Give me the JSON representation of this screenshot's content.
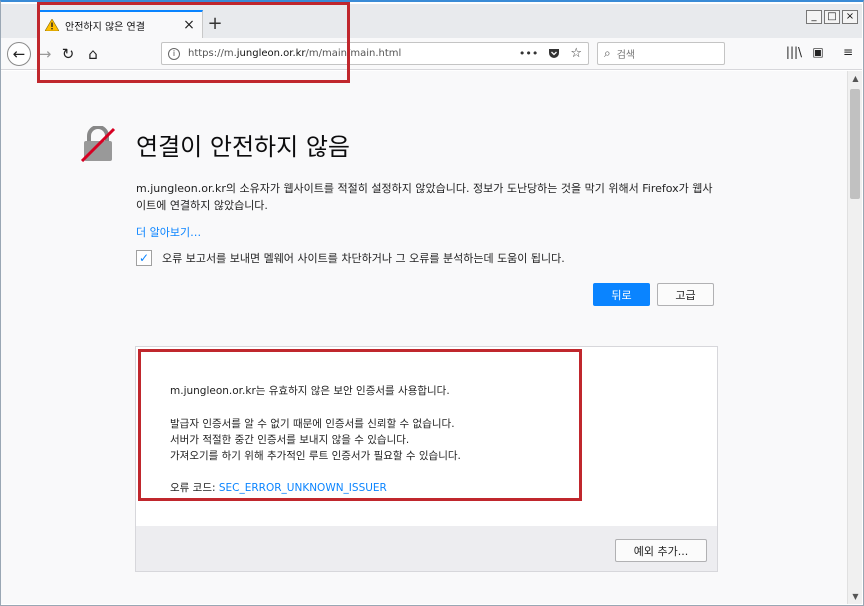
{
  "browser": {
    "tab_title": "안전하지 않은 연결",
    "tab_close": "×",
    "new_tab": "+",
    "window_controls": {
      "minimize": "_",
      "maximize": "□",
      "close": "×"
    }
  },
  "nav": {
    "back": "←",
    "forward": "→",
    "reload": "↻",
    "home": "⌂",
    "url_prefix": "https://m.",
    "url_domain": "jungleon.or.kr",
    "url_path": "/m/main/main.html",
    "url_more": "•••",
    "search_placeholder": "검색",
    "library_icon": "|||\\",
    "sidebar_icon": "▣",
    "menu_icon": "≡"
  },
  "error": {
    "title": "연결이 안전하지 않음",
    "description": "m.jungleon.or.kr의 소유자가 웹사이트를 적절히 설정하지 않았습니다. 정보가 도난당하는 것을 막기 위해서 Firefox가 웹사이트에 연결하지 않았습니다.",
    "learn_more": "더 알아보기…",
    "report_label": "오류 보고서를 보내면 멜웨어 사이트를 차단하거나 그 오류를 분석하는데 도움이 됩니다.",
    "report_checked": true,
    "back_button": "뒤로",
    "advanced_button": "고급"
  },
  "advanced": {
    "line1": "m.jungleon.or.kr는 유효하지 않은 보안 인증서를 사용합니다.",
    "line2": "발급자 인증서를 알 수 없기 때문에 인증서를 신뢰할 수 없습니다.",
    "line3": "서버가 적절한 중간 인증서를 보내지 않을 수 있습니다.",
    "line4": "가져오기를 하기 위해 추가적인 루트 인증서가 필요할 수 있습니다.",
    "error_code_label": "오류 코드: ",
    "error_code": "SEC_ERROR_UNKNOWN_ISSUER",
    "add_exception_button": "예외 추가..."
  },
  "colors": {
    "accent": "#0a84ff",
    "annotation": "#c0272d",
    "warning": "#ffbf00"
  }
}
